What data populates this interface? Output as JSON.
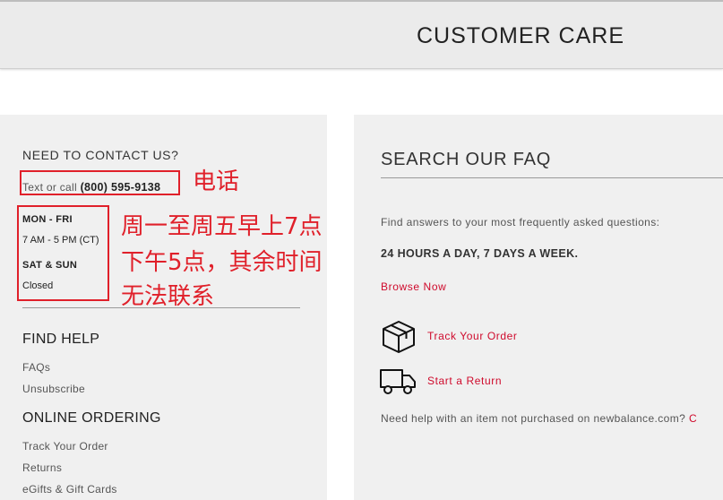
{
  "header": {
    "title": "CUSTOMER CARE"
  },
  "contact": {
    "title": "NEED TO CONTACT US?",
    "call_prefix": "Text or call",
    "phone": "(800) 595-9138",
    "weekday_label": "MON - FRI",
    "weekday_hours": "7 AM - 5 PM (CT)",
    "weekend_label": "SAT & SUN",
    "weekend_hours": "Closed"
  },
  "find_help": {
    "title": "FIND HELP",
    "links": [
      "FAQs",
      "Unsubscribe"
    ]
  },
  "online_ordering": {
    "title": "ONLINE ORDERING",
    "links": [
      "Track Your Order",
      "Returns",
      "eGifts & Gift Cards"
    ]
  },
  "faq": {
    "title": "SEARCH OUR FAQ",
    "description": "Find answers to your most frequently asked questions:",
    "availability": "24 HOURS A DAY, 7 DAYS A WEEK.",
    "browse_label": "Browse Now",
    "track_label": "Track Your Order",
    "return_label": "Start a Return",
    "help_text": "Need help with an item not purchased on newbalance.com?",
    "help_link": "C"
  },
  "annotations": {
    "phone_note": "电话",
    "hours_note_1": "周一至周五早上7点",
    "hours_note_2": "下午5点，其余时间",
    "hours_note_3": "无法联系",
    "color": "#e0202a"
  },
  "icons": {
    "track": "box-icon",
    "return": "truck-icon"
  },
  "colors": {
    "accent_red": "#cf0a2c",
    "panel_bg": "#f0f0f0",
    "header_bg": "#ebebeb"
  }
}
